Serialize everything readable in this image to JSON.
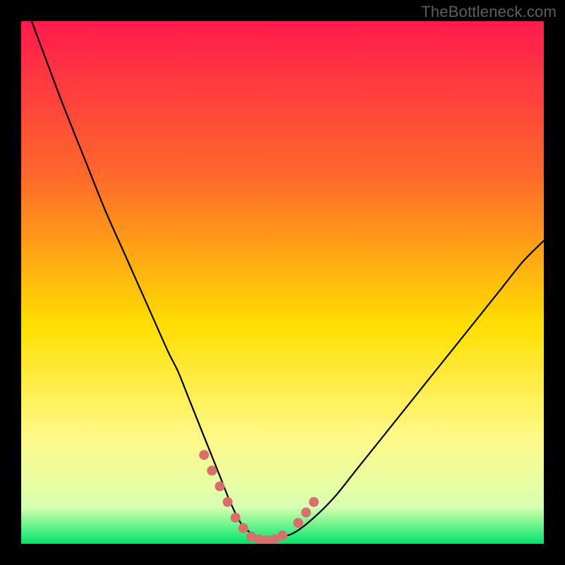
{
  "watermark": "TheBottleneck.com",
  "colors": {
    "bg_top": "#ff1a4d",
    "bg_mid1": "#ff6a2a",
    "bg_mid2": "#ffde00",
    "bg_low1": "#fff98a",
    "bg_low2": "#d9ffb0",
    "bg_bottom": "#00e56a",
    "curve": "#000000",
    "marker": "#d6706d",
    "frame": "#000000"
  },
  "chart_data": {
    "type": "line",
    "title": "",
    "xlabel": "",
    "ylabel": "",
    "xlim": [
      0,
      100
    ],
    "ylim": [
      0,
      100
    ],
    "series": [
      {
        "name": "bottleneck-curve",
        "x": [
          2,
          5,
          8,
          12,
          16,
          20,
          24,
          28,
          30,
          32,
          34,
          36,
          38,
          40,
          42,
          44,
          46,
          48,
          52,
          56,
          60,
          64,
          68,
          72,
          76,
          80,
          84,
          88,
          92,
          96,
          100
        ],
        "y": [
          100,
          92,
          84,
          74,
          64,
          55,
          46,
          37,
          33,
          28,
          23,
          18,
          13,
          8,
          4,
          2,
          1,
          1,
          2,
          5,
          9,
          14,
          19,
          24,
          29,
          34,
          39,
          44,
          49,
          54,
          58
        ]
      }
    ],
    "markers": [
      {
        "name": "left-cluster",
        "x": [
          35,
          36.5,
          38,
          39.5,
          41,
          42.5
        ],
        "y": [
          17,
          14,
          11,
          8,
          5,
          3
        ]
      },
      {
        "name": "bottom-cluster",
        "x": [
          44,
          45.5,
          47,
          48.5,
          50
        ],
        "y": [
          1.4,
          0.9,
          0.7,
          0.9,
          1.6
        ]
      },
      {
        "name": "right-cluster",
        "x": [
          53,
          54.5,
          56
        ],
        "y": [
          4,
          6,
          8
        ]
      }
    ],
    "marker_radius_px": 7
  }
}
